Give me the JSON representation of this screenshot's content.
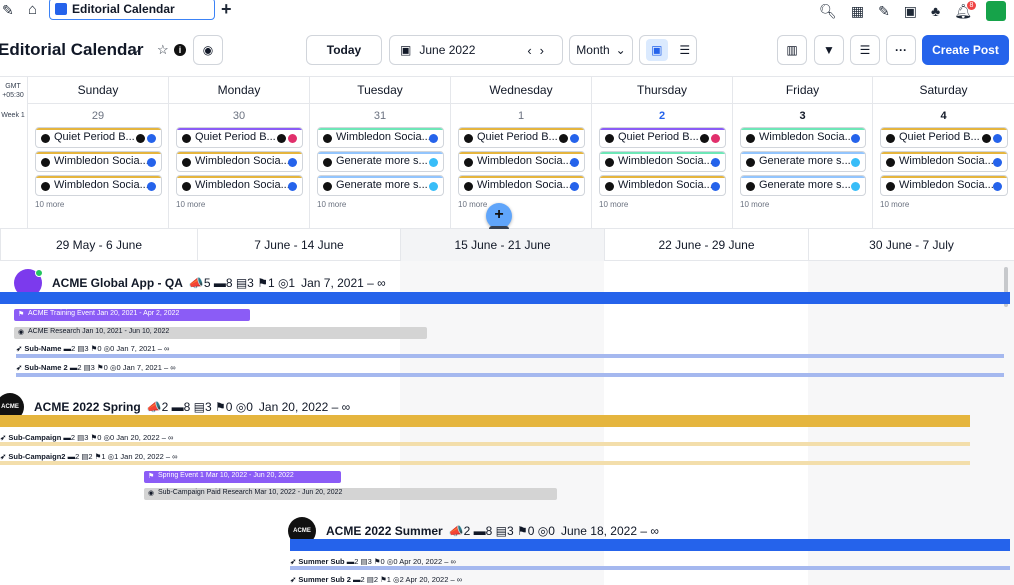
{
  "topbar": {
    "logo": "✎",
    "home": "⌂",
    "tab_label": "Editorial Calendar",
    "add_tab": "+",
    "icons": [
      "search-icon",
      "apps-icon",
      "compose-icon",
      "calendar-icon",
      "people-icon",
      "bell-icon"
    ],
    "notif_count": "8"
  },
  "toolbar": {
    "title": "Editorial Calendar",
    "today": "Today",
    "date_range": "June 2022",
    "view_mode": "Month",
    "create_post": "Create Post"
  },
  "calendar": {
    "gmt": "GMT +05:30",
    "week_label": "Week 1",
    "days": [
      {
        "name": "Sunday",
        "num": "29",
        "state": "dim",
        "posts": [
          {
            "label": "Quiet Period B...",
            "color": "#e5b53e",
            "channel": "#2563eb",
            "extra": true
          },
          {
            "label": "Wimbledon Socia...",
            "color": "#e5b53e",
            "channel": "#2563eb",
            "extra": false
          },
          {
            "label": "Wimbledon Socia...",
            "color": "#e5b53e",
            "channel": "#2563eb",
            "extra": false
          }
        ],
        "more": "10 more"
      },
      {
        "name": "Monday",
        "num": "30",
        "state": "dim",
        "posts": [
          {
            "label": "Quiet Period B...",
            "color": "#8b5cf6",
            "channel": "#e1306c",
            "extra": true
          },
          {
            "label": "Wimbledon Socia...",
            "color": "#e5b53e",
            "channel": "#2563eb",
            "extra": false
          },
          {
            "label": "Wimbledon Socia...",
            "color": "#e5b53e",
            "channel": "#2563eb",
            "extra": false
          }
        ],
        "more": "10 more"
      },
      {
        "name": "Tuesday",
        "num": "31",
        "state": "dim",
        "posts": [
          {
            "label": "Wimbledon Socia...",
            "color": "#6ee7b7",
            "channel": "#2563eb",
            "extra": false
          },
          {
            "label": "Generate more s...",
            "color": "#93c5fd",
            "channel": "#38bdf8",
            "extra": false
          },
          {
            "label": "Generate more s...",
            "color": "#93c5fd",
            "channel": "#38bdf8",
            "extra": false
          }
        ],
        "more": "10 more"
      },
      {
        "name": "Wednesday",
        "num": "1",
        "state": "dim",
        "posts": [
          {
            "label": "Quiet Period B...",
            "color": "#e5b53e",
            "channel": "#2563eb",
            "extra": true
          },
          {
            "label": "Wimbledon Socia...",
            "color": "#e5b53e",
            "channel": "#2563eb",
            "extra": false
          },
          {
            "label": "Wimbledon Socia...",
            "color": "#e5b53e",
            "channel": "#2563eb",
            "extra": false
          }
        ],
        "more": "10 more"
      },
      {
        "name": "Thursday",
        "num": "2",
        "state": "active",
        "posts": [
          {
            "label": "Quiet Period B...",
            "color": "#8b5cf6",
            "channel": "#e1306c",
            "extra": true
          },
          {
            "label": "Wimbledon Socia...",
            "color": "#6ee7b7",
            "channel": "#2563eb",
            "extra": false
          },
          {
            "label": "Wimbledon Socia...",
            "color": "#e5b53e",
            "channel": "#2563eb",
            "extra": false
          }
        ],
        "more": "10 more"
      },
      {
        "name": "Friday",
        "num": "3",
        "state": "bold",
        "posts": [
          {
            "label": "Wimbledon Socia...",
            "color": "#6ee7b7",
            "channel": "#2563eb",
            "extra": false
          },
          {
            "label": "Generate more s...",
            "color": "#93c5fd",
            "channel": "#38bdf8",
            "extra": false
          },
          {
            "label": "Generate more s...",
            "color": "#93c5fd",
            "channel": "#38bdf8",
            "extra": false
          }
        ],
        "more": "10 more"
      },
      {
        "name": "Saturday",
        "num": "4",
        "state": "bold",
        "posts": [
          {
            "label": "Quiet Period B...",
            "color": "#e5b53e",
            "channel": "#2563eb",
            "extra": true
          },
          {
            "label": "Wimbledon Socia...",
            "color": "#e5b53e",
            "channel": "#2563eb",
            "extra": false
          },
          {
            "label": "Wimbledon Socia...",
            "color": "#e5b53e",
            "channel": "#2563eb",
            "extra": false
          }
        ],
        "more": "10 more"
      }
    ]
  },
  "ranges": [
    "29 May - 6 June",
    "7 June - 14 June",
    "15 June - 21 June",
    "22 June - 29 June",
    "30 June - 7 July"
  ],
  "gantt": {
    "global": {
      "name": "ACME Global App - QA",
      "stats": "📣5 ▬8 ▤3 ⚑1 ◎1",
      "dates": "Jan 7, 2021 – ∞",
      "event": "ACME Training Event  Jan 20, 2021 - Apr 2, 2022",
      "research": "ACME Research  Jan 10, 2021 - Jun 10, 2022",
      "sub1": "Sub-Name",
      "sub1_stats": "▬2 ▤3 ⚑0 ◎0 Jan 7, 2021 – ∞",
      "sub2": "Sub-Name 2",
      "sub2_stats": "▬2 ▤3 ⚑0 ◎0 Jan 7, 2021 – ∞"
    },
    "spring": {
      "avatar": "ACME",
      "name": "ACME 2022 Spring",
      "stats": "📣2 ▬8 ▤3 ⚑0 ◎0",
      "dates": "Jan 20, 2022 – ∞",
      "sub1": "Sub-Campaign",
      "sub1_stats": "▬2 ▤3 ⚑0 ◎0 Jan 20, 2022 – ∞",
      "sub2": "Sub-Campaign2",
      "sub2_stats": "▬2 ▤2 ⚑1 ◎1 Jan 20, 2022 – ∞",
      "event": "Spring Event 1  Mar 10, 2022 - Jun 20, 2022",
      "research": "Sub-Campaign Paid Research  Mar 10, 2022 - Jun 20, 2022"
    },
    "summer": {
      "avatar": "ACME",
      "name": "ACME 2022 Summer",
      "stats": "📣2 ▬8 ▤3 ⚑0 ◎0",
      "dates": "June 18, 2022 – ∞",
      "sub1": "Summer Sub",
      "sub1_stats": "▬2 ▤3 ⚑0 ◎0 Apr 20, 2022 – ∞",
      "sub2": "Summer Sub 2",
      "sub2_stats": "▬2 ▤2 ⚑1 ◎2 Apr 20, 2022 – ∞"
    }
  },
  "colors": {
    "accent": "#2563eb",
    "global_bar": "#2563eb",
    "global_thin": "#a5b8ef",
    "spring_bar": "#e5b53e",
    "spring_thin": "#f3deab",
    "event_pill": "#8b5cf6",
    "research_pill": "#d4d4d4"
  }
}
